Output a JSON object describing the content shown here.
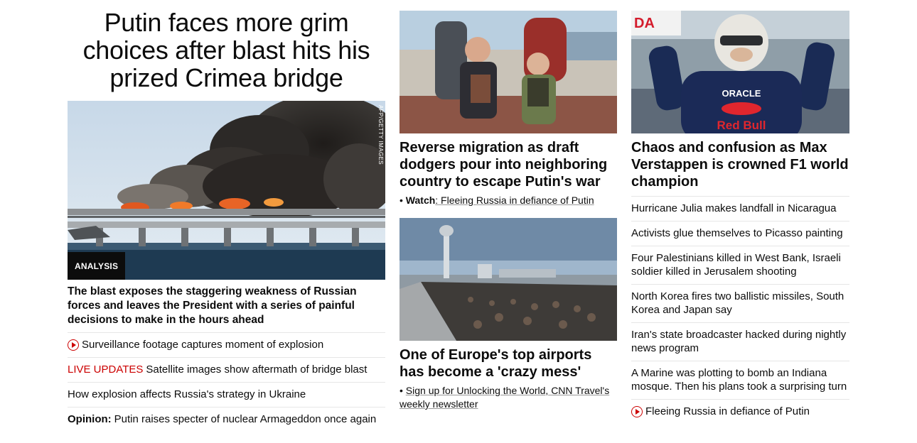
{
  "hero": {
    "title": "Putin faces more grim choices after blast hits his prized Crimea bridge",
    "image_credit": "AFP/GETTY IMAGES",
    "badge": "ANALYSIS",
    "description": "The blast exposes the staggering weakness of Russian forces and leaves the President with a series of painful decisions to make in the hours ahead",
    "links": [
      {
        "text": "Surveillance footage captures moment of explosion",
        "icon": "play-icon"
      },
      {
        "prefix": "LIVE UPDATES",
        "text": "Satellite images show aftermath of bridge blast"
      },
      {
        "text": "How explosion affects Russia's strategy in Ukraine"
      },
      {
        "prefix": "Opinion:",
        "text": "Putin raises specter of nuclear Armageddon once again"
      }
    ]
  },
  "middle": {
    "story1": {
      "title": "Reverse migration as draft dodgers pour into neighboring country to escape Putin's war",
      "bullet": "•",
      "sub_label": "Watch",
      "sub_text": ": Fleeing Russia in defiance of Putin"
    },
    "story2": {
      "title": "One of Europe's top airports has become a 'crazy mess'",
      "bullet": "•",
      "sub_text": "Sign up for Unlocking the World, CNN Travel's weekly newsletter"
    }
  },
  "right": {
    "title": "Chaos and confusion as Max Verstappen is crowned F1 world champion",
    "links": [
      "Hurricane Julia makes landfall in Nicaragua",
      "Activists glue themselves to Picasso painting",
      "Four Palestinians killed in West Bank, Israeli soldier killed in Jerusalem shooting",
      "North Korea fires two ballistic missiles, South Korea and Japan say",
      "Iran's state broadcaster hacked during nightly news program",
      "A Marine was plotting to bomb an Indiana mosque. Then his plans took a surprising turn",
      "Fleeing Russia in defiance of Putin"
    ],
    "photo_text": {
      "brand": "ORACLE",
      "sponsor": "Red Bull",
      "banner": "DA"
    }
  },
  "colors": {
    "accent_red": "#cc0000",
    "text": "#0c0c0c",
    "divider": "#e6e6e6"
  }
}
